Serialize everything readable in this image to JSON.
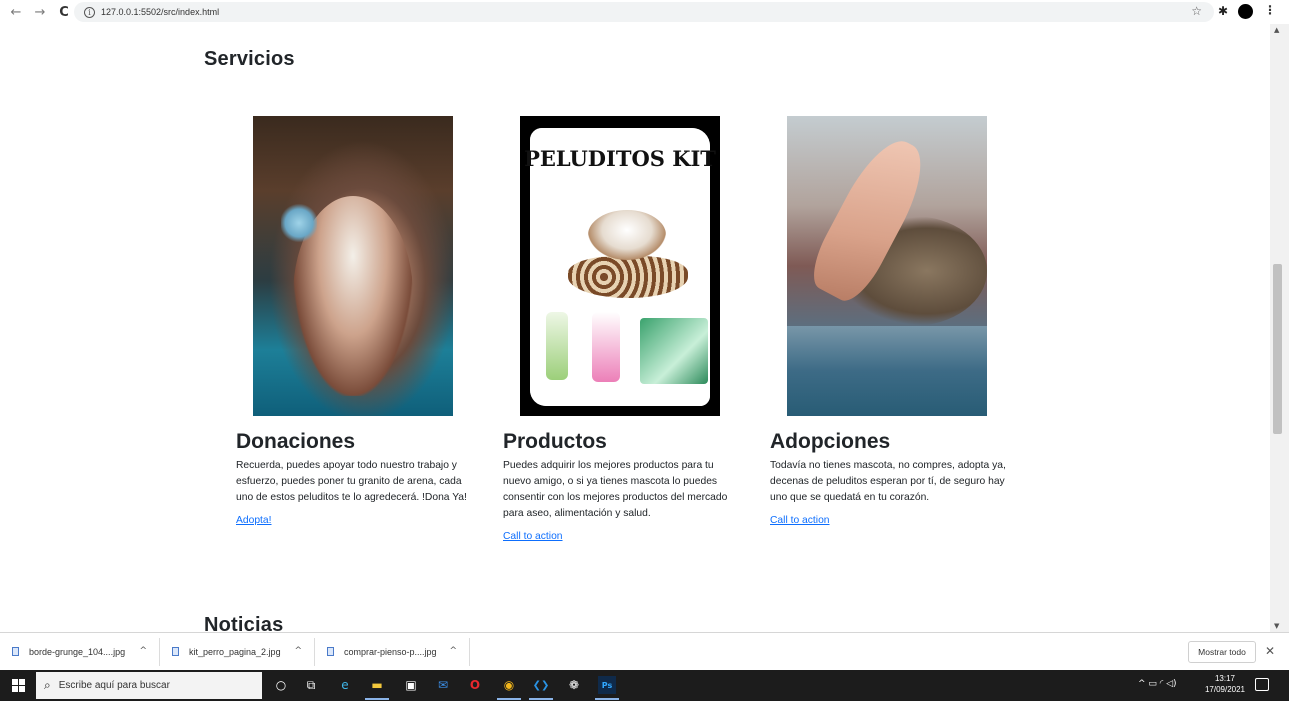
{
  "browser": {
    "back_glyph": "←",
    "forward_glyph": "→",
    "reload_glyph": "C",
    "info_glyph": "i",
    "url": "127.0.0.1:5502/src/index.html",
    "star_glyph": "☆",
    "extensions_glyph": "✱",
    "menu_glyph": "⋮"
  },
  "page": {
    "section_title": "Servicios",
    "next_section_title": "Noticias",
    "cards": [
      {
        "image_icon": "cat-butterfly-photo",
        "title": "Donaciones",
        "text": "Recuerda, puedes apoyar todo nuestro trabajo y esfuerzo, puedes poner tu granito de arena, cada uno de estos peluditos te lo agredecerá. !Dona Ya!",
        "link": "Adopta!"
      },
      {
        "image_icon": "peluditos-kit-photo",
        "image_text": "PELUDITOS KIT",
        "title": "Productos",
        "text": "Puedes adquirir los mejores productos para tu nuevo amigo, o si ya tienes mascota lo puedes consentir con los mejores productos del mercado para aseo, alimentación y salud.",
        "link": "Call to action"
      },
      {
        "image_icon": "high-five-cat-photo",
        "title": "Adopciones",
        "text": "Todavía no tienes mascota, no compres, adopta ya, decenas de peluditos esperan por tí, de seguro hay uno que se quedatá en tu corazón.",
        "link": "Call to action"
      }
    ]
  },
  "scrollbar": {
    "up_glyph": "▲",
    "down_glyph": "▼"
  },
  "downloads": {
    "items": [
      {
        "name": "borde-grunge_104....jpg",
        "caret": "^"
      },
      {
        "name": "kit_perro_pagina_2.jpg",
        "caret": "^"
      },
      {
        "name": "comprar-pienso-p....jpg",
        "caret": "^"
      }
    ],
    "show_all": "Mostrar todo",
    "close_glyph": "✕"
  },
  "taskbar": {
    "search_glyph": "⌕",
    "search_placeholder": "Escribe aquí para buscar",
    "apps": [
      {
        "name": "cortana-icon",
        "glyph": "○"
      },
      {
        "name": "task-view-icon",
        "glyph": "⧉"
      },
      {
        "name": "edge-icon",
        "glyph": "e"
      },
      {
        "name": "file-explorer-icon",
        "glyph": "▬"
      },
      {
        "name": "store-icon",
        "glyph": "▣"
      },
      {
        "name": "mail-icon",
        "glyph": "✉"
      },
      {
        "name": "opera-icon",
        "glyph": "O"
      },
      {
        "name": "chrome-icon",
        "glyph": "◉"
      },
      {
        "name": "vscode-icon",
        "glyph": "❮❯"
      },
      {
        "name": "app-icon",
        "glyph": "❁"
      },
      {
        "name": "photoshop-icon",
        "glyph": "Ps"
      }
    ],
    "tray_glyphs": "^ ▭ ◜ ◁)",
    "time": "13:17",
    "date": "17/09/2021"
  },
  "colors": {
    "link": "#0d6efd",
    "text": "#212529",
    "taskbar": "#1c1c1c"
  }
}
